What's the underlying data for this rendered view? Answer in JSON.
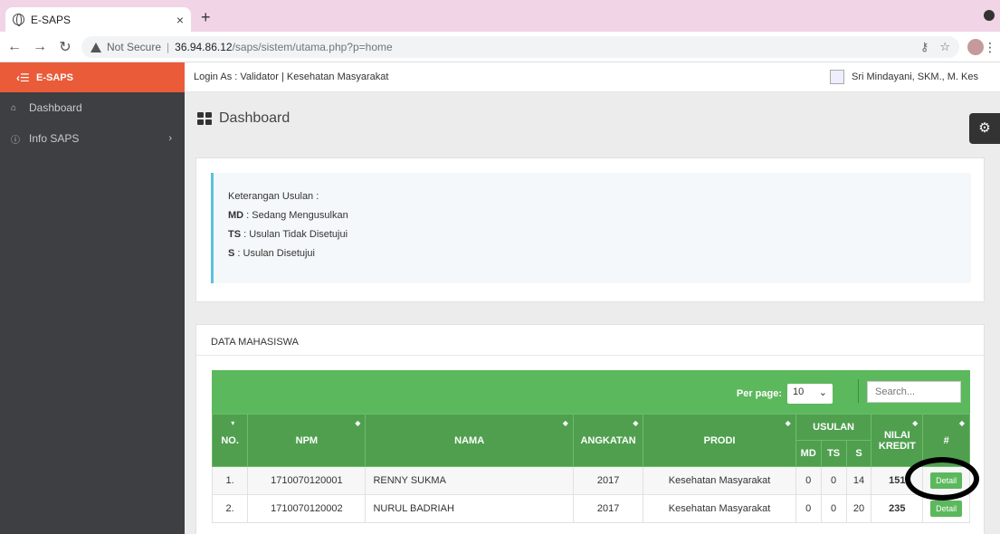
{
  "browser": {
    "tab_title": "E-SAPS",
    "tab_close": "×",
    "new_tab": "+",
    "not_secure": "Not Secure",
    "url_host": "36.94.86.12",
    "url_path": "/saps/sistem/utama.php?p=home"
  },
  "app": {
    "brand": "E-SAPS",
    "login_as": "Login As : Validator | Kesehatan Masyarakat",
    "user_name": "Sri Mindayani, SKM., M. Kes"
  },
  "sidebar": {
    "items": [
      {
        "label": "Dashboard",
        "icon": "home-icon"
      },
      {
        "label": "Info SAPS",
        "icon": "info-icon"
      }
    ]
  },
  "page": {
    "title": "Dashboard"
  },
  "legend": {
    "heading": "Keterangan Usulan :",
    "items": [
      {
        "code": "MD",
        "text": " : Sedang Mengusulkan"
      },
      {
        "code": "TS",
        "text": " : Usulan Tidak Disetujui"
      },
      {
        "code": "S",
        "text": " : Usulan Disetujui"
      }
    ]
  },
  "students": {
    "panel_title": "DATA MAHASISWA",
    "per_page_label": "Per page:",
    "per_page_value": "10",
    "search_placeholder": "Search...",
    "headers": {
      "no": "NO.",
      "npm": "NPM",
      "nama": "NAMA",
      "angkatan": "ANGKATAN",
      "prodi": "PRODI",
      "usulan": "USULAN",
      "md": "MD",
      "ts": "TS",
      "s": "S",
      "nilai_kredit": "NILAI KREDIT",
      "action": "#"
    },
    "rows": [
      {
        "no": "1.",
        "npm": "1710070120001",
        "nama": "RENNY SUKMA",
        "angkatan": "2017",
        "prodi": "Kesehatan Masyarakat",
        "md": "0",
        "ts": "0",
        "s": "14",
        "kredit": "151",
        "action": "Detail"
      },
      {
        "no": "2.",
        "npm": "1710070120002",
        "nama": "NURUL BADRIAH",
        "angkatan": "2017",
        "prodi": "Kesehatan Masyarakat",
        "md": "0",
        "ts": "0",
        "s": "20",
        "kredit": "235",
        "action": "Detail"
      }
    ]
  }
}
